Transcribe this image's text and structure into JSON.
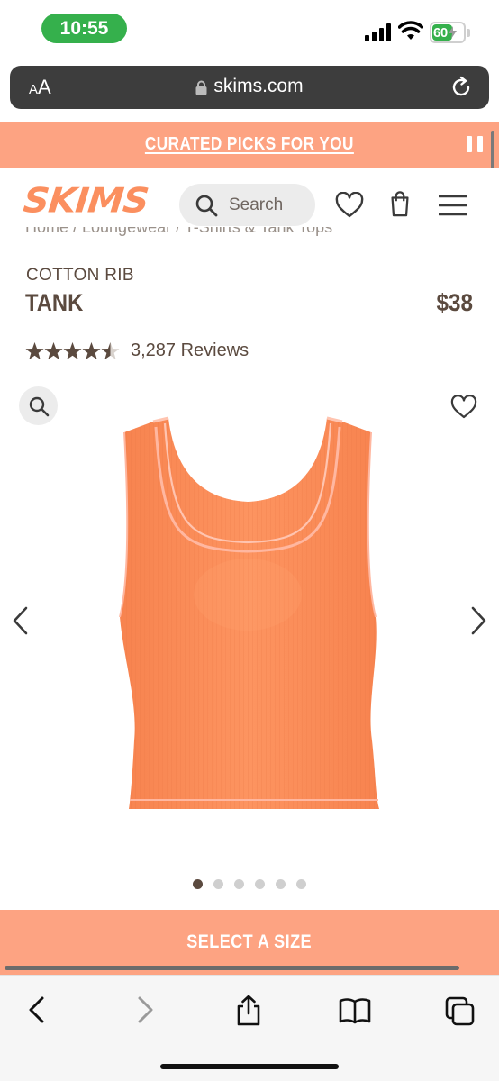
{
  "status_bar": {
    "time": "10:55",
    "battery": "60",
    "battery_level": 0.6,
    "icons": [
      "cellular-signal-icon",
      "wifi-icon",
      "battery-charging-icon"
    ]
  },
  "browser": {
    "text_size_label_small": "A",
    "text_size_label_large": "A",
    "url": "skims.com",
    "icons": [
      "lock-icon",
      "reload-icon"
    ]
  },
  "promo": {
    "text": "CURATED PICKS FOR YOU",
    "background": "#fda382"
  },
  "header": {
    "logo": "SKIMS",
    "logo_color": "#fb8f5f",
    "search_placeholder": "Search",
    "icons": [
      "search-icon",
      "wishlist-heart-icon",
      "shopping-bag-icon",
      "hamburger-menu-icon"
    ]
  },
  "breadcrumb": {
    "text": "Home / Loungewear / T-Shirts & Tank Tops"
  },
  "product": {
    "eyebrow": "COTTON RIB",
    "title": "TANK",
    "price": "$38",
    "rating": 4.5,
    "reviews": "3,287 Reviews",
    "text_color": "#5b4a3f",
    "product_color": "#fb8f5f"
  },
  "gallery": {
    "image_count": 6,
    "active_index": 0
  },
  "cta": {
    "label": "SELECT A SIZE"
  },
  "toolbar": {
    "icons": [
      "back-icon",
      "forward-icon",
      "share-icon",
      "bookmarks-icon",
      "tabs-icon"
    ]
  }
}
